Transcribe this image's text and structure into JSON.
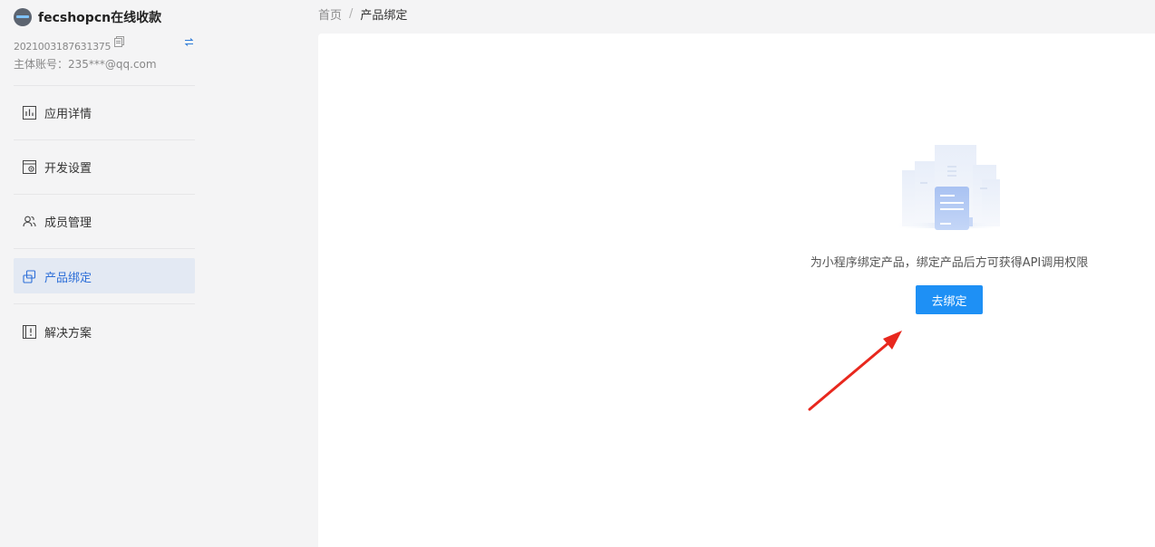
{
  "sidebar": {
    "app_name": "fecshopcn在线收款",
    "app_id": "2021003187631375",
    "account": "主体账号：235***@qq.com",
    "items": [
      {
        "label": "应用详情",
        "icon": "chart-icon"
      },
      {
        "label": "开发设置",
        "icon": "settings-window-icon"
      },
      {
        "label": "成员管理",
        "icon": "members-icon"
      },
      {
        "label": "产品绑定",
        "icon": "link-icon",
        "active": true
      },
      {
        "label": "解决方案",
        "icon": "solution-icon"
      }
    ]
  },
  "breadcrumb": {
    "home": "首页",
    "separator": "/",
    "current": "产品绑定"
  },
  "main": {
    "empty_message": "为小程序绑定产品，绑定产品后方可获得API调用权限",
    "bind_button_label": "去绑定"
  },
  "colors": {
    "accent": "#1e90f5",
    "active_text": "#2e6fd8",
    "active_bg": "#e3e9f3",
    "arrow": "#e8281e"
  }
}
